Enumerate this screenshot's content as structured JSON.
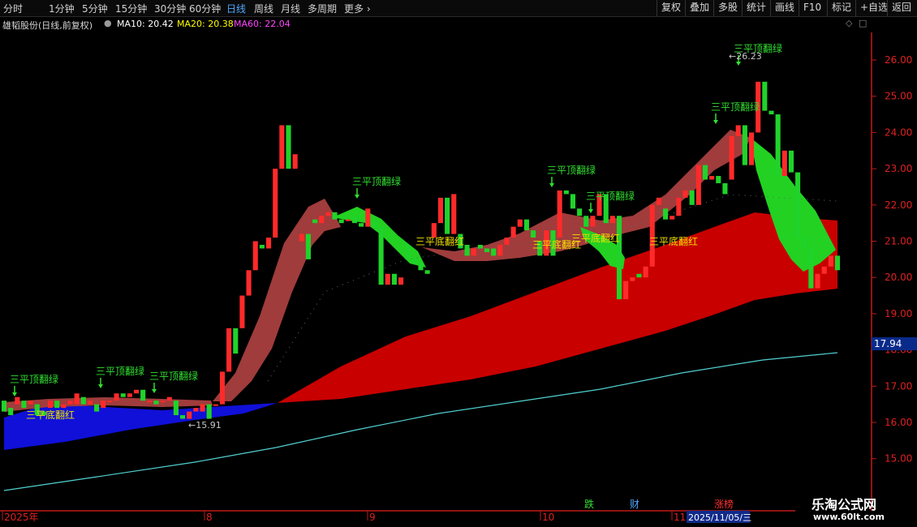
{
  "toolbar": {
    "periods": [
      "分时",
      "1分钟",
      "5分钟",
      "15分钟",
      "30分钟",
      "60分钟",
      "日线",
      "周线",
      "月线",
      "多周期"
    ],
    "active_period": "日线",
    "more_label": "更多",
    "right_buttons": [
      "复权",
      "叠加",
      "多股",
      "统计",
      "画线",
      "F10",
      "标记",
      "+自选",
      "返回"
    ]
  },
  "info": {
    "title": "雄韬股份(日线,前复权)",
    "ma10": "MA10: 20.42",
    "ma20": "MA20: 20.38",
    "ma60": "MA60: 22.04"
  },
  "colors": {
    "up": "#ff2a2a",
    "down": "#1fd32a",
    "ma10": "#ffffff",
    "ma20": "#ffff00",
    "ma60": "#ff44ff",
    "axis": "#c01818",
    "price_label_bg": "#0a2a8a",
    "annotation_green": "#31e031",
    "annotation_yellow": "#f0e000"
  },
  "y_axis": {
    "ticks": [
      "26.00",
      "25.00",
      "24.00",
      "23.00",
      "22.00",
      "21.00",
      "20.00",
      "19.00",
      "18.00",
      "17.00",
      "16.00",
      "15.00"
    ],
    "current_price_label": "17.94"
  },
  "x_axis": {
    "labels": [
      "2025年",
      "8",
      "9",
      "10",
      "11"
    ],
    "date_label": "2025/11/05/三"
  },
  "markers": [
    {
      "text": "跌",
      "color": "#31e031"
    },
    {
      "text": "财",
      "color": "#4fa8ff"
    },
    {
      "text": "涨榜",
      "color": "#ff3030"
    }
  ],
  "annotations": {
    "top_flip": "三平顶翻绿",
    "bottom_flip": "三平底翻红",
    "high_price": "26.23",
    "low_price": "15.91"
  },
  "watermark": {
    "title": "乐淘公式网",
    "url": "www.60lt.com"
  },
  "chart_data": {
    "type": "candlestick",
    "x_labels": [
      "2025年",
      "8",
      "9",
      "10",
      "11"
    ],
    "ylim": [
      14.6,
      26.6
    ],
    "candles": [
      {
        "o": 16.6,
        "c": 16.3
      },
      {
        "o": 16.4,
        "c": 16.2
      },
      {
        "o": 16.5,
        "c": 16.7
      },
      {
        "o": 16.6,
        "c": 16.4
      },
      {
        "o": 16.5,
        "c": 16.6
      },
      {
        "o": 16.5,
        "c": 16.2
      },
      {
        "o": 16.3,
        "c": 16.2
      },
      {
        "o": 16.4,
        "c": 16.6
      },
      {
        "o": 16.6,
        "c": 16.4
      },
      {
        "o": 16.4,
        "c": 16.5
      },
      {
        "o": 16.5,
        "c": 16.6
      },
      {
        "o": 16.5,
        "c": 16.8
      },
      {
        "o": 16.7,
        "c": 16.5
      },
      {
        "o": 16.5,
        "c": 16.6
      },
      {
        "o": 16.5,
        "c": 16.3
      },
      {
        "o": 16.4,
        "c": 16.6
      },
      {
        "o": 16.6,
        "c": 16.6
      },
      {
        "o": 16.6,
        "c": 16.8
      },
      {
        "o": 16.8,
        "c": 16.7
      },
      {
        "o": 16.7,
        "c": 16.8
      },
      {
        "o": 16.8,
        "c": 16.9
      },
      {
        "o": 16.9,
        "c": 16.6
      },
      {
        "o": 16.6,
        "c": 16.6
      },
      {
        "o": 16.6,
        "c": 16.5
      },
      {
        "o": 16.6,
        "c": 16.6
      },
      {
        "o": 16.6,
        "c": 16.7
      },
      {
        "o": 16.6,
        "c": 16.2
      },
      {
        "o": 16.2,
        "c": 16.1
      },
      {
        "o": 16.1,
        "c": 16.3
      },
      {
        "o": 16.3,
        "c": 16.4
      },
      {
        "o": 16.3,
        "c": 16.5
      },
      {
        "o": 16.5,
        "c": 16.1
      },
      {
        "o": 16.5,
        "c": 16.5
      },
      {
        "o": 16.5,
        "c": 17.4
      },
      {
        "o": 17.4,
        "c": 18.6
      },
      {
        "o": 18.6,
        "c": 17.9
      },
      {
        "o": 18.6,
        "c": 19.5
      },
      {
        "o": 19.5,
        "c": 20.2
      },
      {
        "o": 20.2,
        "c": 21.0
      },
      {
        "o": 20.9,
        "c": 20.8
      },
      {
        "o": 20.8,
        "c": 21.1
      },
      {
        "o": 21.1,
        "c": 23.0
      },
      {
        "o": 23.0,
        "c": 24.2
      },
      {
        "o": 24.2,
        "c": 23.0
      },
      {
        "o": 23.0,
        "c": 23.4
      },
      {
        "o": 21.0,
        "c": 21.2
      },
      {
        "o": 21.2,
        "c": 20.5
      },
      {
        "o": 21.6,
        "c": 21.5
      },
      {
        "o": 21.5,
        "c": 21.7
      },
      {
        "o": 21.7,
        "c": 21.8
      },
      {
        "o": 21.8,
        "c": 21.6
      },
      {
        "o": 21.6,
        "c": 21.5
      },
      {
        "o": 21.6,
        "c": 21.6
      },
      {
        "o": 21.7,
        "c": 21.5
      },
      {
        "o": 21.5,
        "c": 21.4
      },
      {
        "o": 21.4,
        "c": 21.9
      },
      {
        "o": 21.6,
        "c": 21.4
      },
      {
        "o": 21.4,
        "c": 19.8
      },
      {
        "o": 19.8,
        "c": 20.1
      },
      {
        "o": 20.1,
        "c": 19.8
      },
      {
        "o": 19.8,
        "c": 20.0
      },
      {
        "o": 20.9,
        "c": 20.5
      },
      {
        "o": 20.5,
        "c": 20.4
      },
      {
        "o": 20.4,
        "c": 20.2
      },
      {
        "o": 20.2,
        "c": 20.1
      },
      {
        "o": 21.1,
        "c": 21.5
      },
      {
        "o": 21.5,
        "c": 22.2
      },
      {
        "o": 22.2,
        "c": 21.2
      },
      {
        "o": 21.2,
        "c": 22.3
      },
      {
        "o": 21.2,
        "c": 20.8
      },
      {
        "o": 20.9,
        "c": 20.6
      },
      {
        "o": 20.6,
        "c": 20.8
      },
      {
        "o": 20.9,
        "c": 20.8
      },
      {
        "o": 20.8,
        "c": 20.7
      },
      {
        "o": 20.8,
        "c": 20.6
      },
      {
        "o": 20.6,
        "c": 20.9
      },
      {
        "o": 20.9,
        "c": 21.1
      },
      {
        "o": 21.1,
        "c": 21.4
      },
      {
        "o": 21.4,
        "c": 21.6
      },
      {
        "o": 21.6,
        "c": 21.3
      },
      {
        "o": 21.3,
        "c": 21.1
      },
      {
        "o": 21.0,
        "c": 20.6
      },
      {
        "o": 20.6,
        "c": 21.3
      },
      {
        "o": 21.3,
        "c": 20.6
      },
      {
        "o": 21.1,
        "c": 22.4
      },
      {
        "o": 22.4,
        "c": 22.3
      },
      {
        "o": 22.3,
        "c": 21.9
      },
      {
        "o": 21.9,
        "c": 21.7
      },
      {
        "o": 21.7,
        "c": 21.4
      },
      {
        "o": 21.4,
        "c": 21.7
      },
      {
        "o": 21.7,
        "c": 22.3
      },
      {
        "o": 22.3,
        "c": 21.5
      },
      {
        "o": 21.5,
        "c": 21.7
      },
      {
        "o": 21.7,
        "c": 19.4
      },
      {
        "o": 19.4,
        "c": 19.9
      },
      {
        "o": 19.9,
        "c": 20.0
      },
      {
        "o": 20.1,
        "c": 20.0
      },
      {
        "o": 20.0,
        "c": 20.3
      },
      {
        "o": 20.3,
        "c": 22.0
      },
      {
        "o": 22.0,
        "c": 22.2
      },
      {
        "o": 21.9,
        "c": 21.6
      },
      {
        "o": 21.6,
        "c": 21.7
      },
      {
        "o": 21.7,
        "c": 22.2
      },
      {
        "o": 22.2,
        "c": 22.4
      },
      {
        "o": 22.4,
        "c": 22.0
      },
      {
        "o": 22.0,
        "c": 23.1
      },
      {
        "o": 23.1,
        "c": 22.7
      },
      {
        "o": 22.7,
        "c": 22.8
      },
      {
        "o": 22.8,
        "c": 22.6
      },
      {
        "o": 22.6,
        "c": 22.3
      },
      {
        "o": 22.7,
        "c": 23.9
      },
      {
        "o": 23.9,
        "c": 24.2
      },
      {
        "o": 24.2,
        "c": 23.1
      },
      {
        "o": 23.1,
        "c": 24.0
      },
      {
        "o": 24.0,
        "c": 25.4
      },
      {
        "o": 25.4,
        "c": 24.6
      },
      {
        "o": 24.6,
        "c": 24.5
      },
      {
        "o": 24.5,
        "c": 22.8
      },
      {
        "o": 22.8,
        "c": 23.5
      },
      {
        "o": 23.5,
        "c": 22.9
      },
      {
        "o": 22.9,
        "c": 21.1
      },
      {
        "o": 21.1,
        "c": 20.8
      },
      {
        "o": 20.8,
        "c": 19.7
      },
      {
        "o": 19.7,
        "c": 20.1
      },
      {
        "o": 20.1,
        "c": 20.3
      },
      {
        "o": 20.3,
        "c": 20.6
      },
      {
        "o": 20.6,
        "c": 20.2
      }
    ]
  }
}
